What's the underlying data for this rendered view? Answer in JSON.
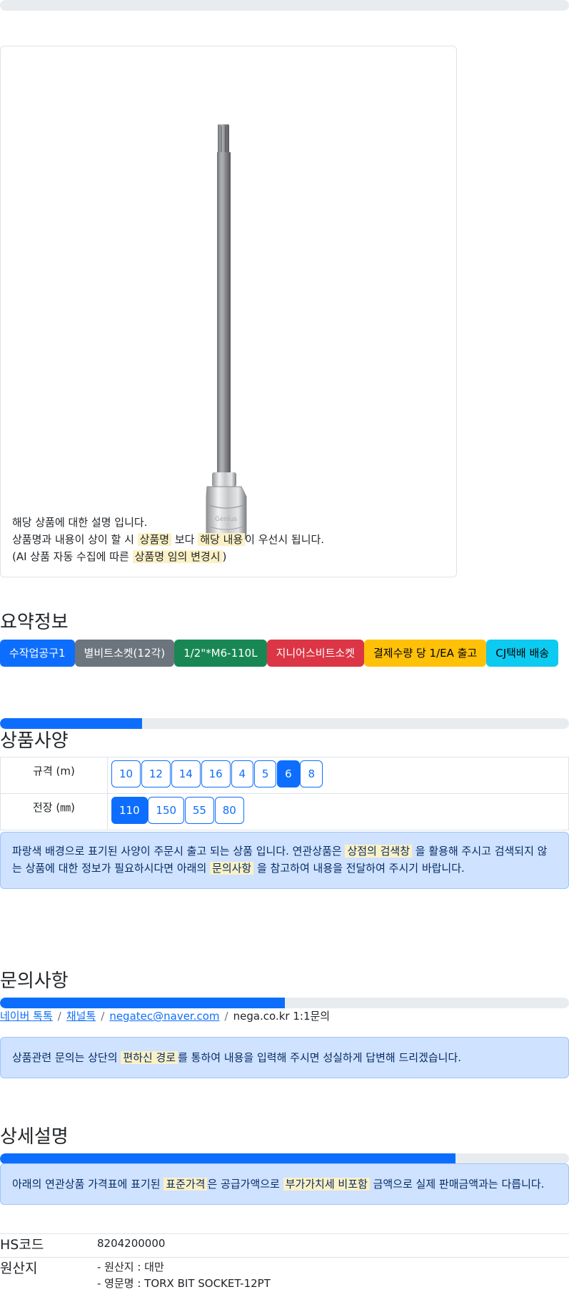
{
  "top_progress": 0,
  "product": {
    "image_alt": "토크스 비트 소켓",
    "desc_lines": {
      "line1": "해당 상품에 대한 설명 입니다.",
      "line2_a": "상품명과 내용이 상이 할 시 ",
      "line2_mark1": "상품명",
      "line2_b": " 보다 ",
      "line2_mark2": "해당 내용",
      "line2_c": "이 우선시 됩니다.",
      "line3_a": "(AI 상품 자동 수집에 따른 ",
      "line3_mark": "상품명 임의 변경시",
      "line3_b": ")"
    }
  },
  "summary": {
    "title": "요약정보",
    "badges": [
      "수작업공구1",
      "별비트소켓(12각)",
      "1/2\"*M6-110L",
      "지니어스비트소켓",
      "결제수량 당 1/EA 출고",
      "CJ택배 배송"
    ]
  },
  "spec": {
    "progress": 0.25,
    "title": "상품사양",
    "rows": [
      {
        "label": "규격 (m)",
        "options": [
          "10",
          "12",
          "14",
          "16",
          "4",
          "5",
          "6",
          "8"
        ],
        "selected": "6"
      },
      {
        "label": "전장 (㎜)",
        "options": [
          "110",
          "150",
          "55",
          "80"
        ],
        "selected": "110"
      }
    ],
    "notice": {
      "a": "파랑색 배경으로 표기된 사양이 주문시 출고 되는 상품 입니다. 연관상품은 ",
      "mark1": "상점의 검색창",
      "b": " 을 활용해 주시고 검색되지 않는 상품에 대한 정보가 필요하시다면 아래의 ",
      "mark2": "문의사항",
      "c": " 을 참고하여 내용을 전달하여 주시기 바랍니다."
    }
  },
  "inquiry": {
    "title": "문의사항",
    "progress": 0.5,
    "links": [
      "네이버 톡톡",
      "채널톡",
      "negatec@naver.com"
    ],
    "plain": "nega.co.kr 1:1문의",
    "notice": {
      "a": "상품관련 문의는 상단의 ",
      "mark": "편하신 경로",
      "b": "를 통하여 내용을 입력해 주시면 성실하게 답변해 드리겠습니다."
    }
  },
  "detail": {
    "title": "상세설명",
    "progress": 0.8,
    "notice": {
      "a": "아래의 연관상품 가격표에 표기된 ",
      "mark1": "표준가격",
      "b": "은 공급가액으로 ",
      "mark2": "부가가치세 비포함",
      "c": " 금액으로 실제 판매금액과는 다릅니다."
    },
    "hs_label": "HS코드",
    "hs_value": "8204200000",
    "origin_label": "원산지",
    "origin_line1": "- 원산지 : 대만",
    "origin_line2": "- 영문명 : TORX BIT SOCKET-12PT"
  }
}
